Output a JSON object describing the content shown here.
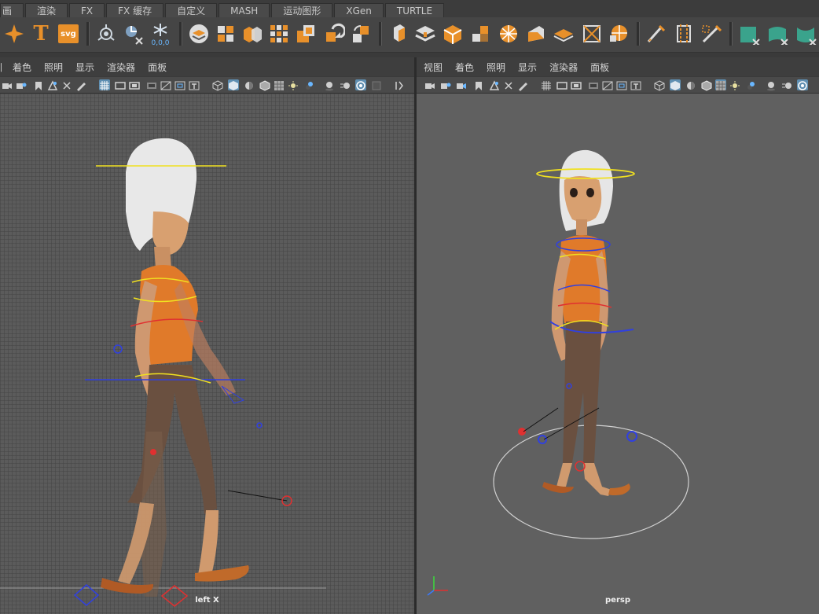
{
  "shelf_tabs": [
    "画",
    "渲染",
    "FX",
    "FX 缓存",
    "自定义",
    "MASH",
    "运动图形",
    "XGen",
    "TURTLE"
  ],
  "shelf_icons": {
    "coord_readout": "0,0,0",
    "text_icon_label": "T",
    "svg_icon_label": "svg"
  },
  "left_panel": {
    "menu": [
      "着色",
      "照明",
      "显示",
      "渲染器",
      "面板"
    ],
    "camera_label": "left X"
  },
  "right_panel": {
    "menu": [
      "视图",
      "着色",
      "照明",
      "显示",
      "渲染器",
      "面板"
    ],
    "camera_label": "persp"
  },
  "colors": {
    "accent_orange": "#e8902a",
    "selected_blue": "#5f8fb2",
    "teal_icon": "#3aa38c",
    "rig_red": "#e03030",
    "rig_blue": "#3040e0",
    "rig_yellow": "#f0e020"
  }
}
